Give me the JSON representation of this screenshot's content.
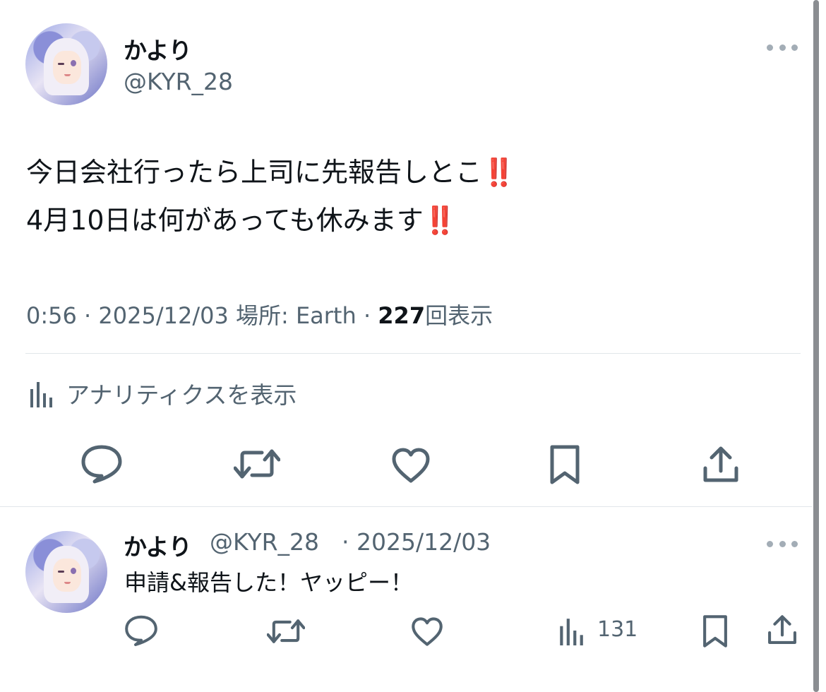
{
  "main_tweet": {
    "display_name": "かより",
    "handle": "@KYR_28",
    "text_line1": "今日会社行ったら上司に先報告しとこ",
    "text_line2": "4月10日は何があっても休みます",
    "emphasis": "‼️",
    "time": "0:56",
    "date": "2025/12/03",
    "location": "場所: Earth",
    "view_count": "227",
    "view_label": "回表示",
    "separator": "·",
    "analytics_label": "アナリティクスを表示"
  },
  "reply_tweet": {
    "display_name": "かより",
    "handle": "@KYR_28",
    "date": "· 2025/12/03",
    "text": "申請&報告した！ヤッピー！",
    "view_count": "131"
  },
  "icons": [
    "avatar",
    "more-icon",
    "analytics-icon",
    "reply-icon",
    "retweet-icon",
    "like-icon",
    "bookmark-icon",
    "share-icon"
  ],
  "colors": {
    "text": "#0f1419",
    "secondary": "#536471",
    "emphasis": "#e0262b",
    "divider": "#e1e6ea"
  }
}
